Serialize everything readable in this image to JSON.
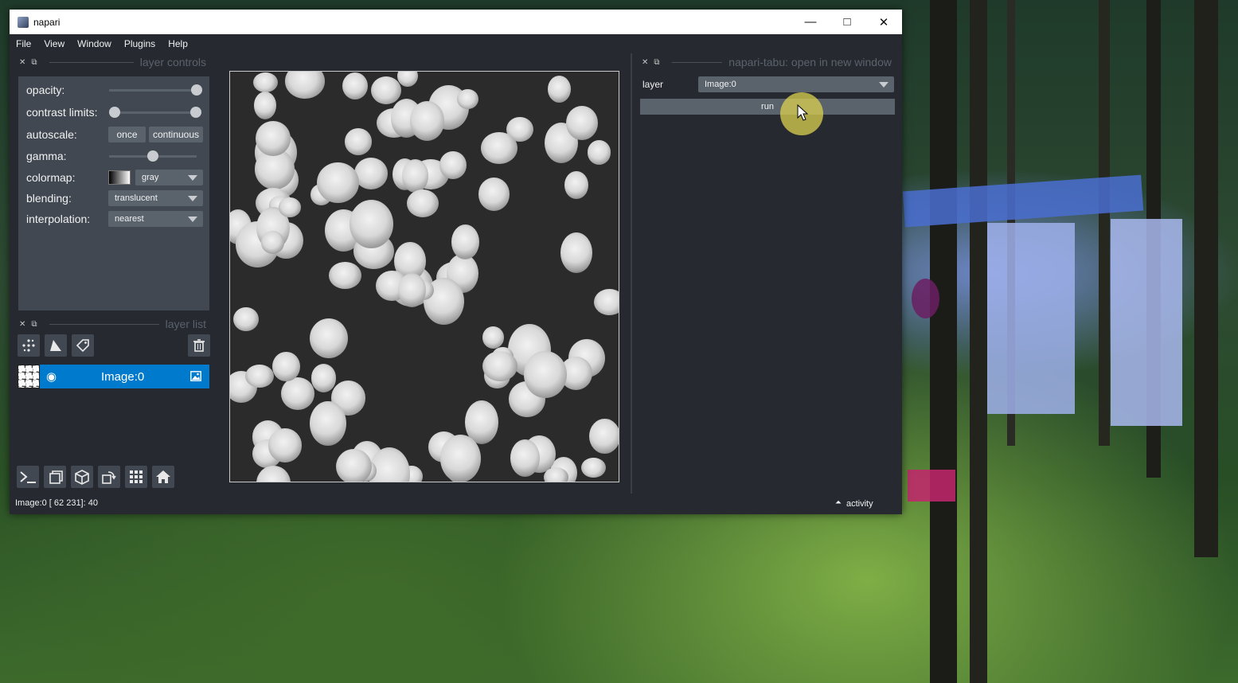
{
  "window": {
    "title": "napari",
    "controls": {
      "minimize": "—",
      "maximize": "□",
      "close": "✕"
    }
  },
  "menu": [
    "File",
    "View",
    "Window",
    "Plugins",
    "Help"
  ],
  "layer_controls": {
    "title": "layer controls",
    "opacity_label": "opacity:",
    "opacity_value": 1.0,
    "contrast_label": "contrast limits:",
    "contrast_range": [
      0.0,
      1.0
    ],
    "autoscale_label": "autoscale:",
    "autoscale_once": "once",
    "autoscale_continuous": "continuous",
    "gamma_label": "gamma:",
    "gamma_value": 0.5,
    "colormap_label": "colormap:",
    "colormap_value": "gray",
    "blending_label": "blending:",
    "blending_value": "translucent",
    "interpolation_label": "interpolation:",
    "interpolation_value": "nearest"
  },
  "layer_list": {
    "title": "layer list",
    "layers": [
      {
        "name": "Image:0",
        "visible": true,
        "type": "image"
      }
    ]
  },
  "plugin_dock": {
    "title": "napari-tabu: open in new window",
    "layer_label": "layer",
    "layer_value": "Image:0",
    "run_label": "run"
  },
  "status": {
    "text": "Image:0 [ 62 231]: 40",
    "activity_label": "activity",
    "activity_icon": "⏶"
  },
  "icons": {
    "dock_close": "✕",
    "dock_float": "⧉",
    "visibility": "◉",
    "image_type": "image-icon"
  },
  "colors": {
    "accent": "#007acc",
    "background": "#262930",
    "foreground": "#414851"
  }
}
